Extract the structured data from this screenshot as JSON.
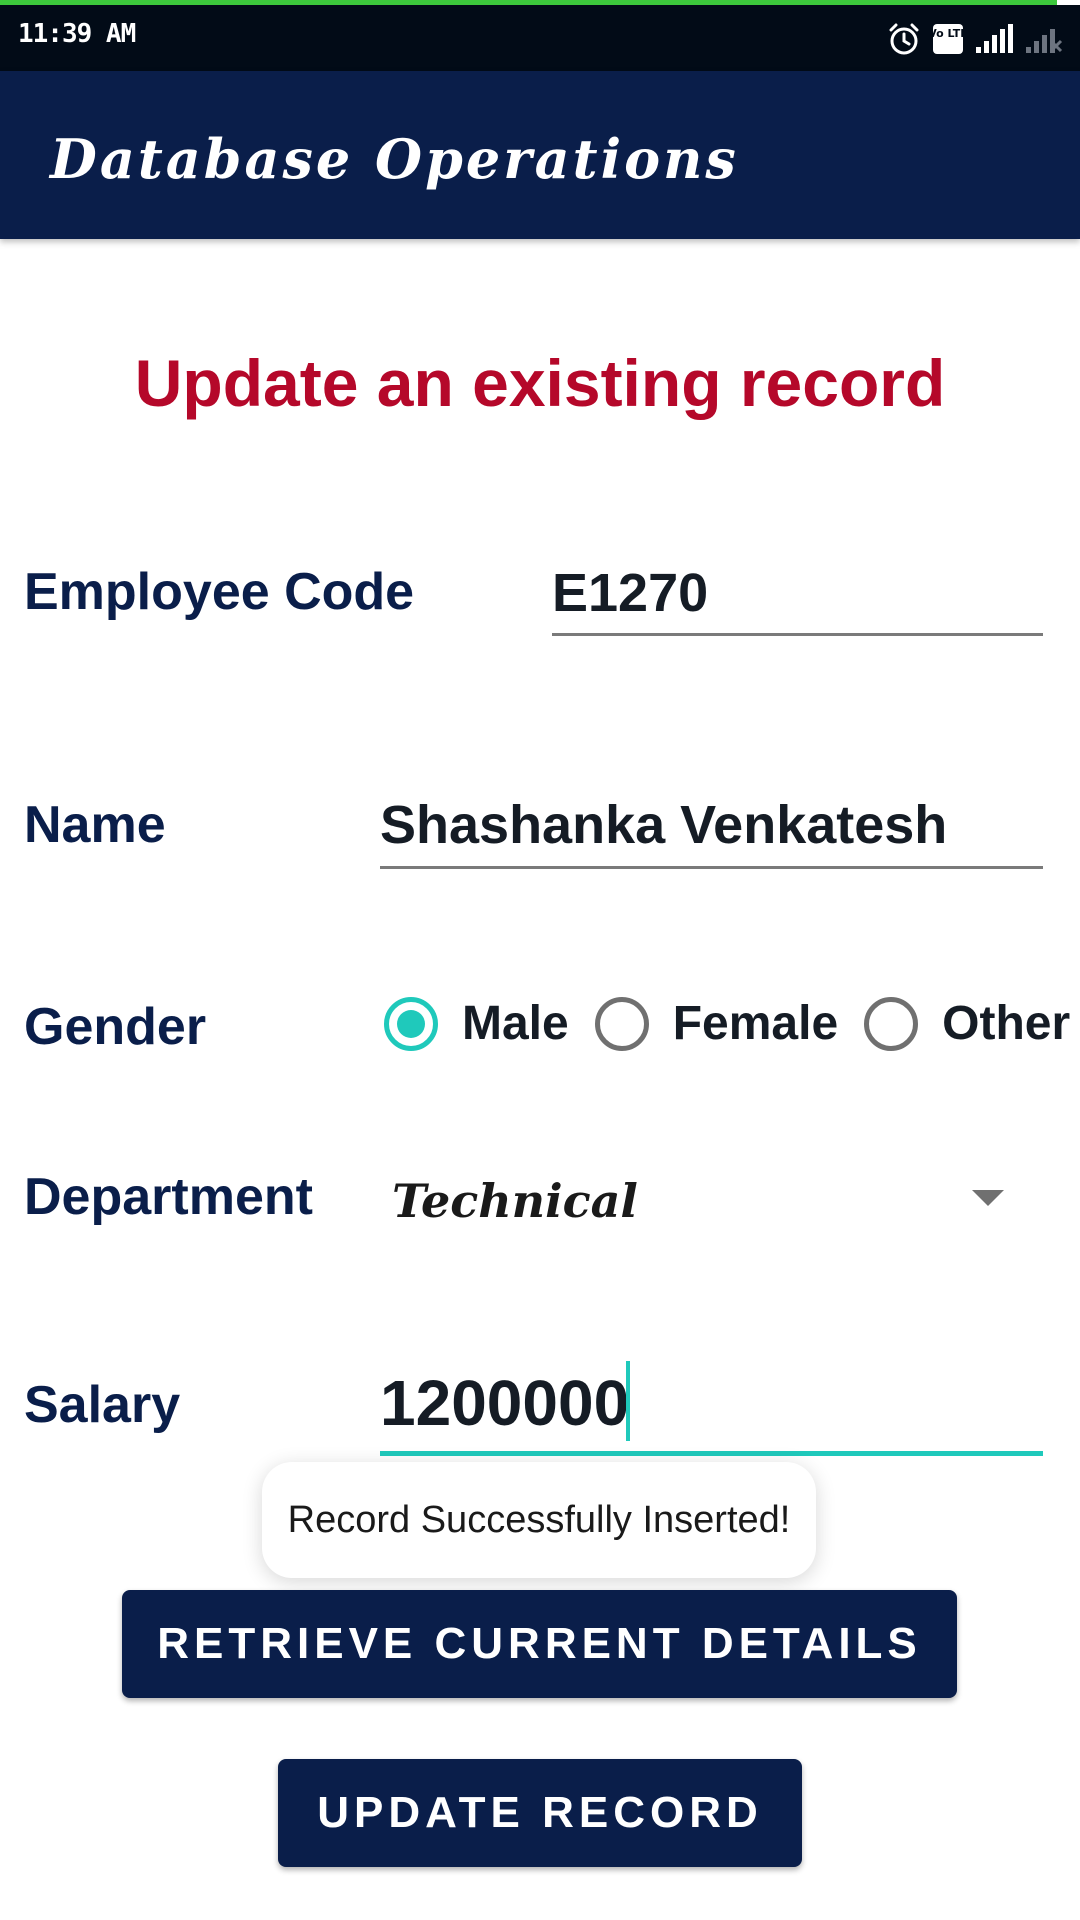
{
  "status_bar": {
    "time": "11:39 AM",
    "icons": [
      "alarm-icon",
      "volte-icon",
      "signal-icon",
      "no-signal-icon"
    ],
    "volte_label": "Vo LTE"
  },
  "app_bar": {
    "title": "Database Operations"
  },
  "page": {
    "heading": "Update an existing record"
  },
  "form": {
    "employee_code": {
      "label": "Employee Code",
      "value": "E1270"
    },
    "name": {
      "label": "Name",
      "value": "Shashanka Venkatesh"
    },
    "gender": {
      "label": "Gender",
      "options": [
        "Male",
        "Female",
        "Other"
      ],
      "selected": "Male"
    },
    "department": {
      "label": "Department",
      "value": "Technical"
    },
    "salary": {
      "label": "Salary",
      "value": "1200000"
    }
  },
  "toast": {
    "message": "Record Successfully Inserted!"
  },
  "buttons": {
    "retrieve_label": "RETRIEVE CURRENT DETAILS",
    "update_label": "UPDATE RECORD"
  },
  "colors": {
    "primary": "#0a1e4a",
    "heading": "#b5082a",
    "accent": "#1fc9bb",
    "progress": "#3cc83c"
  }
}
